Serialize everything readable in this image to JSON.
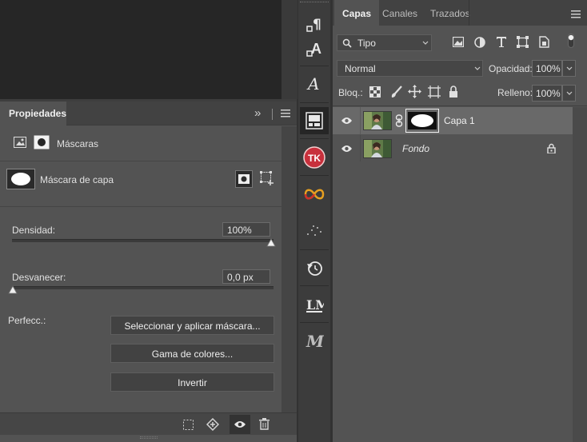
{
  "properties": {
    "tab_label": "Propiedades",
    "expand_glyph": "»",
    "section_title": "Máscaras",
    "mask_name": "Máscara de capa",
    "density_label": "Densidad:",
    "density_value": "100%",
    "density_level": 1.0,
    "feather_label": "Desvanecer:",
    "feather_value": "0,0 px",
    "feather_level": 0.0,
    "refine_label": "Perfecc.:",
    "btn_select_mask": "Seleccionar y aplicar máscara...",
    "btn_color_range": "Gama de colores...",
    "btn_invert": "Invertir"
  },
  "layers_panel": {
    "tabs": [
      "Capas",
      "Canales",
      "Trazados"
    ],
    "active_tab": "Capas",
    "filter_kind": "Tipo",
    "blend_mode": "Normal",
    "opacity_label": "Opacidad:",
    "opacity_value": "100%",
    "lock_label": "Bloq.:",
    "fill_label": "Relleno:",
    "fill_value": "100%",
    "layers": [
      {
        "name": "Capa 1",
        "selected": true,
        "has_mask": true
      },
      {
        "name": "Fondo",
        "selected": false,
        "locked": true
      }
    ]
  },
  "tool_icons": [
    "paragraph-icon",
    "character-icon",
    "glyph-a-icon",
    "properties-icon",
    "tk-plugin-icon",
    "infinity-plugin-icon",
    "scatter-icon",
    "history-icon",
    "lm-plugin-icon",
    "m-script-icon"
  ],
  "colors": {
    "panel": "#535353",
    "dark": "#424242",
    "canvas": "#262626",
    "selected_row": "#696969"
  }
}
